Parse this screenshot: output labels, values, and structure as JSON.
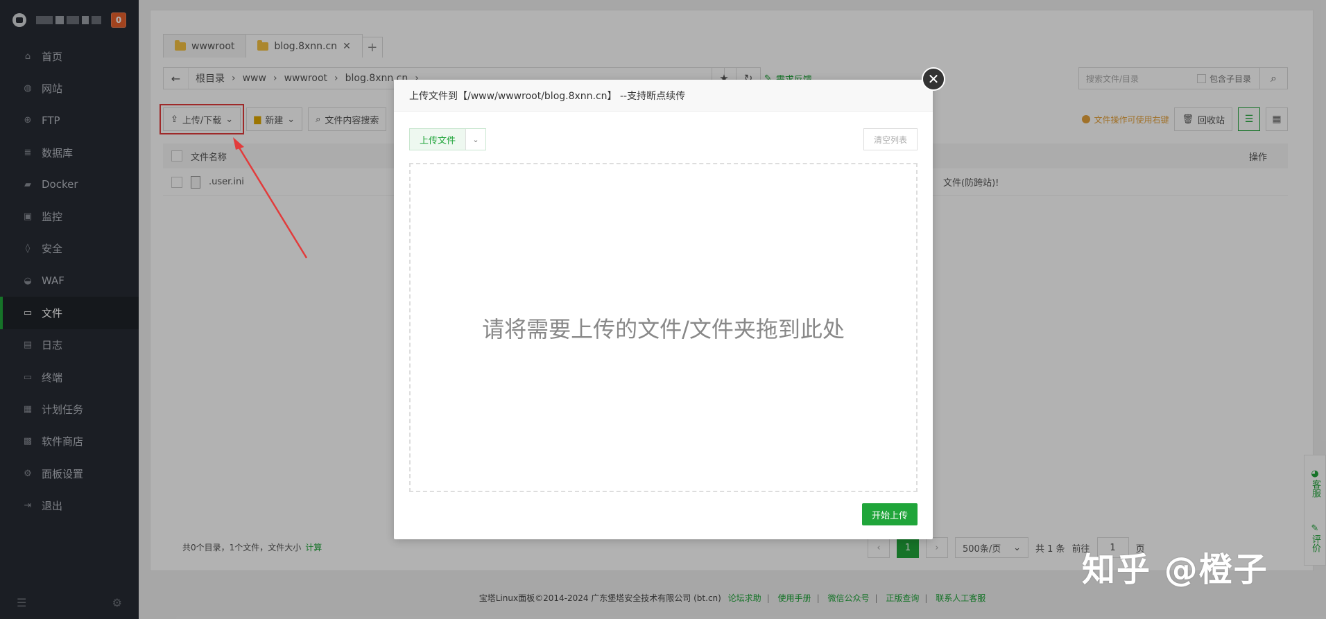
{
  "sidebar": {
    "badge": "0",
    "items": [
      {
        "label": "首页",
        "icon": "home-icon"
      },
      {
        "label": "网站",
        "icon": "globe-icon"
      },
      {
        "label": "FTP",
        "icon": "ftp-icon"
      },
      {
        "label": "数据库",
        "icon": "database-icon"
      },
      {
        "label": "Docker",
        "icon": "docker-icon"
      },
      {
        "label": "监控",
        "icon": "monitor-icon"
      },
      {
        "label": "安全",
        "icon": "shield-icon"
      },
      {
        "label": "WAF",
        "icon": "waf-icon"
      },
      {
        "label": "文件",
        "icon": "folder-icon"
      },
      {
        "label": "日志",
        "icon": "log-icon"
      },
      {
        "label": "终端",
        "icon": "terminal-icon"
      },
      {
        "label": "计划任务",
        "icon": "calendar-icon"
      },
      {
        "label": "软件商店",
        "icon": "store-icon"
      },
      {
        "label": "面板设置",
        "icon": "gear-icon"
      },
      {
        "label": "退出",
        "icon": "logout-icon"
      }
    ],
    "active_item": "文件"
  },
  "tabs": [
    {
      "label": "wwwroot"
    },
    {
      "label": "blog.8xnn.cn"
    }
  ],
  "tab_add": "+",
  "path": {
    "crumbs": [
      "根目录",
      "www",
      "wwwroot",
      "blog.8xnn.cn"
    ],
    "feedback": "需求反馈"
  },
  "search": {
    "placeholder": "搜索文件/目录",
    "include_sub": "包含子目录"
  },
  "toolbar": {
    "upload_download": "上传/下载",
    "new": "新建",
    "content_search": "文件内容搜索",
    "tip": "文件操作可使用右键",
    "recycle": "回收站"
  },
  "table": {
    "col_name": "文件名称",
    "col_ops": "操作",
    "rows": [
      {
        "name": ".user.ini"
      }
    ],
    "row_note": "文件(防跨站)!"
  },
  "footer": {
    "summary": "共0个目录，1个文件，文件大小",
    "calc": "计算"
  },
  "pager": {
    "current": "1",
    "per_page": "500条/页",
    "total": "共 1 条",
    "goto_label": "前往",
    "goto_value": "1",
    "page_unit": "页"
  },
  "copyright": {
    "text": "宝塔Linux面板©2014-2024 广东堡塔安全技术有限公司 (bt.cn)",
    "links": [
      "论坛求助",
      "使用手册",
      "微信公众号",
      "正版查询",
      "联系人工客服"
    ]
  },
  "float": {
    "service": "客服",
    "review": "评价"
  },
  "modal": {
    "title": "上传文件到【/www/wwwroot/blog.8xnn.cn】 --支持断点续传",
    "upload_file": "上传文件",
    "clear_list": "清空列表",
    "drop_hint": "请将需要上传的文件/文件夹拖到此处",
    "start_upload": "开始上传"
  },
  "watermark": "知乎 @橙子",
  "colors": {
    "accent": "#20a53a",
    "sidebar_bg": "#282c34",
    "highlight": "#e23b3b",
    "warning": "#e6a23c"
  }
}
